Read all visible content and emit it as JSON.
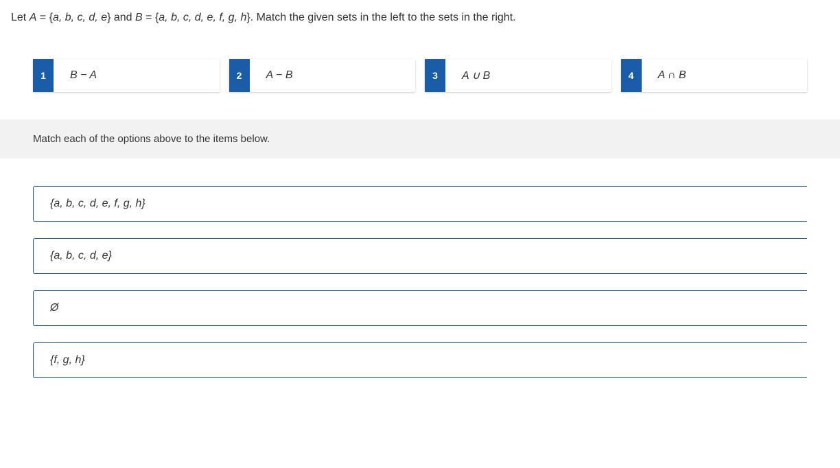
{
  "question": {
    "prefix": "Let ",
    "setA_lhs": "A",
    "eq": " = {",
    "setA_elems": "a, b, c, d, e",
    "brace_close": "} and ",
    "setB_lhs": "B",
    "eq2": " = {",
    "setB_elems": "a, b, c, d, e, f, g, h",
    "suffix": "}. Match the given sets in the left to the sets in the right."
  },
  "options": [
    {
      "num": "1",
      "label": "B − A"
    },
    {
      "num": "2",
      "label": "A − B"
    },
    {
      "num": "3",
      "label": "A ∪ B"
    },
    {
      "num": "4",
      "label": "A ∩ B"
    }
  ],
  "instruction": "Match each of the options above to the items below.",
  "targets": [
    "{a, b, c, d, e, f, g, h}",
    "{a, b, c, d, e}",
    "Ø",
    "{f, g, h}"
  ]
}
